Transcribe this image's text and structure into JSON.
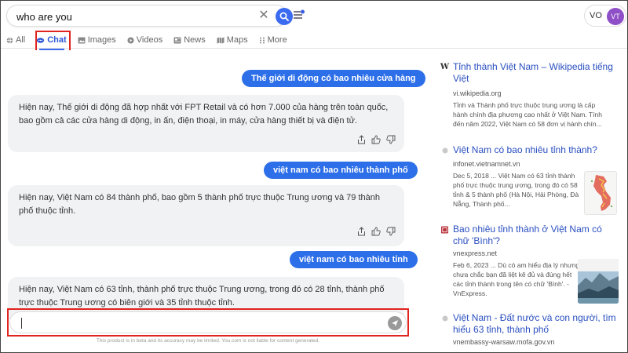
{
  "search": {
    "query": "who are you"
  },
  "profile": {
    "initials": "VO",
    "avatar": "VT"
  },
  "tabs": [
    {
      "label": "All",
      "icon": "globe-icon"
    },
    {
      "label": "Chat",
      "icon": "chat-icon"
    },
    {
      "label": "Images",
      "icon": "image-icon"
    },
    {
      "label": "Videos",
      "icon": "play-icon"
    },
    {
      "label": "News",
      "icon": "news-icon"
    },
    {
      "label": "Maps",
      "icon": "map-icon"
    },
    {
      "label": "More",
      "icon": "grid-icon"
    }
  ],
  "chat": {
    "messages": [
      {
        "user": "Thế giới di động có bao nhiêu cửa hàng",
        "bot": "Hiện nay, Thế giới di động đã hợp nhất với FPT Retail và có hơn 7.000 của hàng trên toàn quốc, bao gồm cả các cửa hàng di động, in ấn, điện thoại, in máy, cửa hàng thiết bị và điện tử."
      },
      {
        "user": "việt nam có bao nhiêu thành phố",
        "bot": "Hiện nay, Việt Nam có 84 thành phố, bao gồm 5 thành phố trực thuộc Trung ương và 79 thành phố thuộc tỉnh."
      },
      {
        "user": "việt nam có bao nhiêu tỉnh",
        "bot": "Hiện nay, Việt Nam có 63 tỉnh, thành phố trực thuộc Trung ương, trong đó có 28 tỉnh, thành phố trực thuộc Trung ương có biên giới và 35 tỉnh thuộc tỉnh."
      }
    ],
    "disclaimer": "This product is in beta and its accuracy may be limited. You.com is not liable for content generated."
  },
  "results": [
    {
      "title": "Tỉnh thành Việt Nam – Wikipedia tiếng Việt",
      "domain": "vi.wikipedia.org",
      "snippet": "Tỉnh và Thành phố trực thuộc trung ương là cấp hành chính địa phương cao nhất ở Việt Nam. Tính đến năm 2022, Việt Nam có 58 đơn vị hành chín...",
      "icon": "wikipedia-icon"
    },
    {
      "title": "Việt Nam có bao nhiêu tỉnh thành?",
      "domain": "infonet.vietnamnet.vn",
      "snippet": "Dec 5, 2018 ... Việt Nam có 63 tỉnh thành phố trực thuộc trung ương, trong đó có 58 tỉnh & 5 thành phố (Hà Nội, Hải Phòng, Đà Nẵng, Thành phố...",
      "icon": "dot-icon"
    },
    {
      "title": "Bao nhiêu tỉnh thành ở Việt Nam có chữ 'Bình'?",
      "domain": "vnexpress.net",
      "snippet": "Feb 6, 2023 ... Dù có am hiểu địa lý nhưng chưa chắc bạn đã liệt kê đủ và đúng hết các tỉnh thành trong tên có chữ 'Bình'. - VnExpress.",
      "icon": "vnexpress-icon"
    },
    {
      "title": "Việt Nam - Đất nước và con người, tìm hiểu 63 tỉnh, thành phố",
      "domain": "vnembassy-warsaw.mofa.gov.vn",
      "snippet": "",
      "icon": "dot-icon"
    }
  ]
}
